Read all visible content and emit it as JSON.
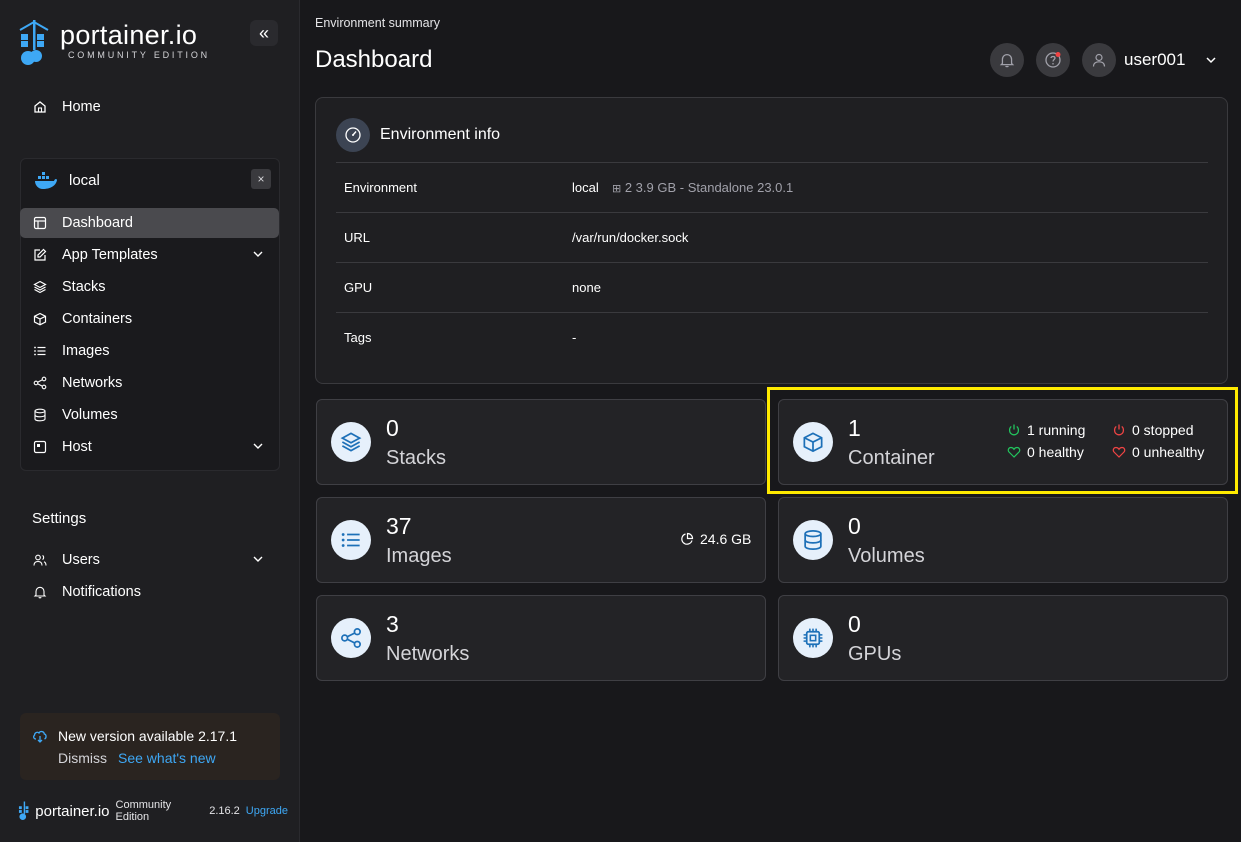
{
  "brand": {
    "name": "portainer.io",
    "edition": "COMMUNITY EDITION"
  },
  "sidebar": {
    "home_label": "Home",
    "environment": {
      "name": "local",
      "items": [
        {
          "label": "Dashboard",
          "active": true
        },
        {
          "label": "App Templates",
          "expandable": true
        },
        {
          "label": "Stacks"
        },
        {
          "label": "Containers"
        },
        {
          "label": "Images"
        },
        {
          "label": "Networks"
        },
        {
          "label": "Volumes"
        },
        {
          "label": "Host",
          "expandable": true
        }
      ]
    },
    "settings_label": "Settings",
    "settings_items": [
      {
        "label": "Users",
        "expandable": true
      },
      {
        "label": "Notifications"
      }
    ],
    "update": {
      "title": "New version available 2.17.1",
      "dismiss": "Dismiss",
      "link": "See what's new"
    },
    "footer": {
      "brand": "portainer.io",
      "edition": "Community Edition",
      "version": "2.16.2",
      "upgrade": "Upgrade"
    }
  },
  "header": {
    "breadcrumb": "Environment summary",
    "title": "Dashboard",
    "user": "user001"
  },
  "environment_info": {
    "title": "Environment info",
    "rows": [
      {
        "key": "Environment",
        "value": "local",
        "meta": "2  3.9 GB - Standalone 23.0.1"
      },
      {
        "key": "URL",
        "value": "/var/run/docker.sock"
      },
      {
        "key": "GPU",
        "value": "none"
      },
      {
        "key": "Tags",
        "value": "-"
      }
    ]
  },
  "cards": {
    "stacks": {
      "count": "0",
      "label": "Stacks"
    },
    "containers": {
      "count": "1",
      "label": "Container",
      "running": "1 running",
      "stopped": "0 stopped",
      "healthy": "0 healthy",
      "unhealthy": "0 unhealthy"
    },
    "images": {
      "count": "37",
      "label": "Images",
      "size": "24.6 GB"
    },
    "volumes": {
      "count": "0",
      "label": "Volumes"
    },
    "networks": {
      "count": "3",
      "label": "Networks"
    },
    "gpus": {
      "count": "0",
      "label": "GPUs"
    }
  },
  "colors": {
    "accent": "#3ea8f5",
    "highlight": "#ffea00",
    "running": "#22c55e",
    "stopped": "#ef4444"
  }
}
